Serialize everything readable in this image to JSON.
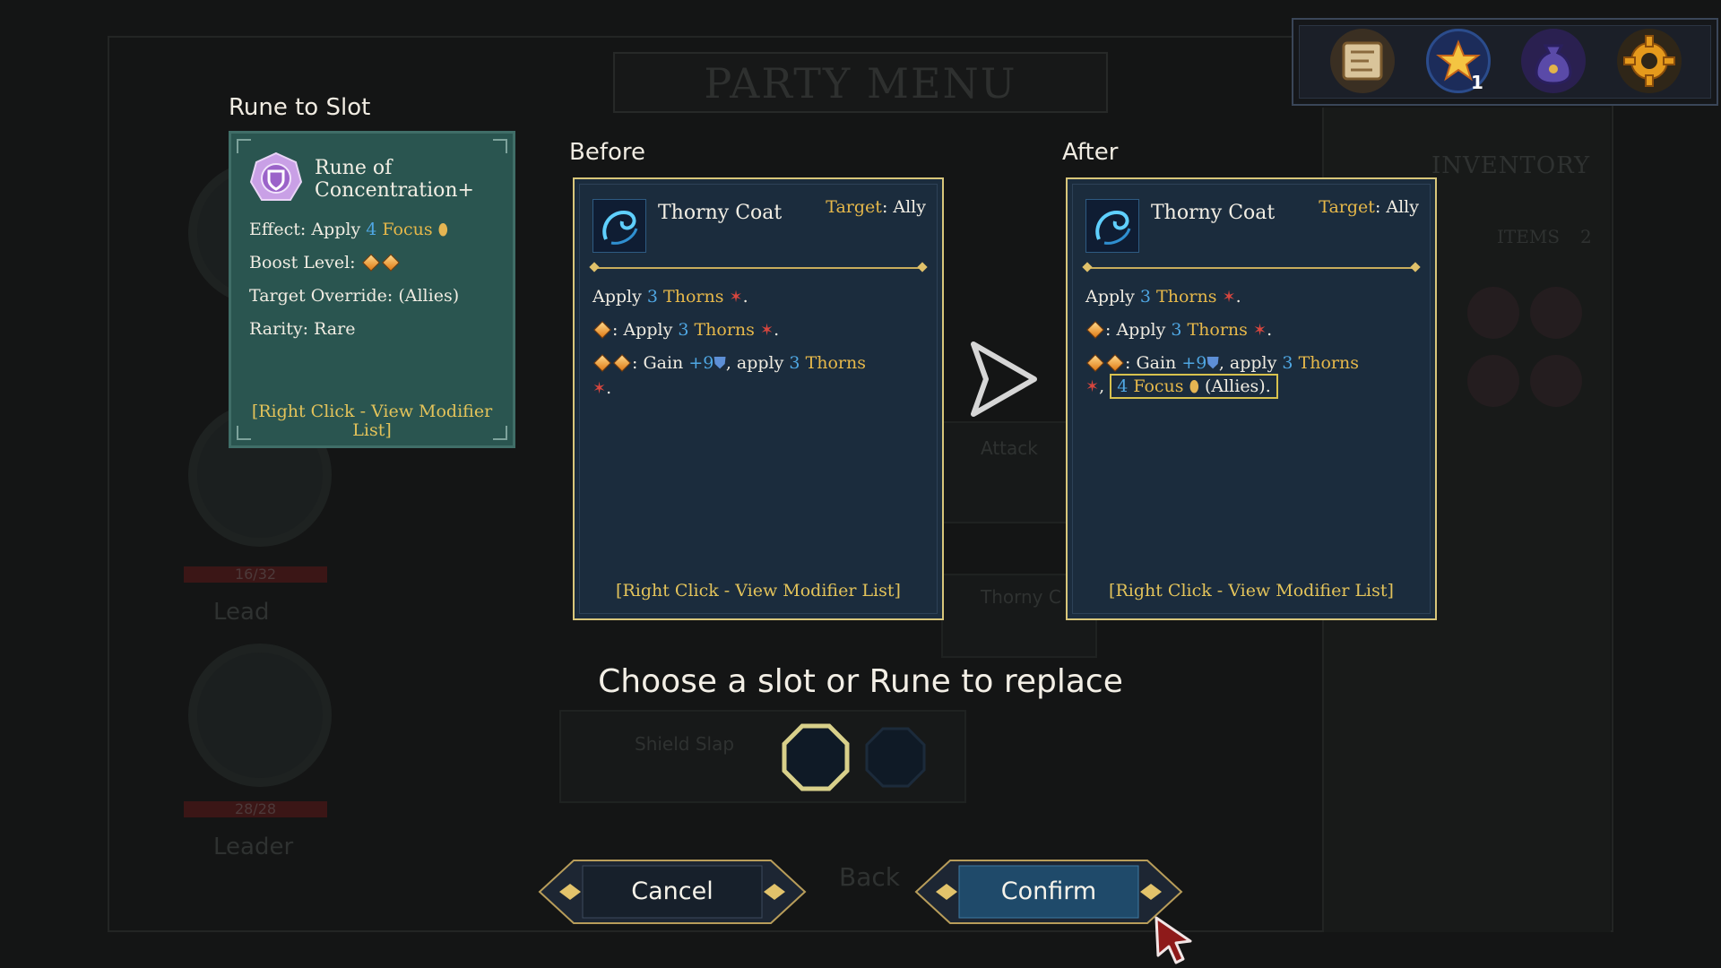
{
  "background": {
    "title": "PARTY MENU",
    "inventory_title": "INVENTORY",
    "inventory_items_label": "ITEMS",
    "inventory_items_count": "2",
    "hp_1": "16/32",
    "hp_2": "28/28",
    "role_1": "Lead",
    "role_2": "Leader",
    "back_label": "Back",
    "skill_attack": "Attack",
    "skill_shield_slap": "Shield Slap",
    "skill_thorny": "Thorny C"
  },
  "toolbar": {
    "items": [
      {
        "name": "map-scroll-icon",
        "glyph": "📜"
      },
      {
        "name": "star-points-icon",
        "glyph": "✦",
        "badge": "1"
      },
      {
        "name": "pouch-icon",
        "glyph": "👝"
      },
      {
        "name": "settings-gear-icon",
        "glyph": "⚙"
      }
    ]
  },
  "rune_to_slot": {
    "heading": "Rune to Slot",
    "name": "Rune of Concentration+",
    "effect_label": "Effect: Apply",
    "effect_amount": "4",
    "effect_status": "Focus",
    "boost_label": "Boost Level:",
    "target_override": "Target Override: (Allies)",
    "rarity": "Rarity: Rare",
    "hint": "[Right Click - View Modifier List]"
  },
  "before": {
    "heading": "Before",
    "name": "Thorny Coat",
    "target_label": "Target",
    "target_value": ": Ally",
    "line1_prefix": "Apply",
    "line1_amount": "3",
    "line1_status": "Thorns",
    "line2_prefix": ": Apply",
    "line2_amount": "3",
    "line2_status": "Thorns",
    "line3_prefix": ": Gain",
    "line3_gain": "+9",
    "line3_mid": ", apply",
    "line3_amount": "3",
    "line3_status": "Thorns",
    "hint": "[Right Click - View Modifier List]"
  },
  "after": {
    "heading": "After",
    "name": "Thorny Coat",
    "target_label": "Target",
    "target_value": ": Ally",
    "line1_prefix": "Apply",
    "line1_amount": "3",
    "line1_status": "Thorns",
    "line2_prefix": ": Apply",
    "line2_amount": "3",
    "line2_status": "Thorns",
    "line3_prefix": ": Gain",
    "line3_gain": "+9",
    "line3_mid": ", apply",
    "line3_amount": "3",
    "line3_status": "Thorns",
    "added_amount": "4",
    "added_status": "Focus",
    "added_suffix": "(Allies).",
    "hint": "[Right Click - View Modifier List]"
  },
  "prompt": "Choose a slot or Rune to replace",
  "buttons": {
    "cancel": "Cancel",
    "confirm": "Confirm"
  },
  "colors": {
    "rune_card_bg": "#2a5550",
    "skill_card_bg": "#1b2c3d",
    "gold_text": "#e6b84a",
    "blue_text": "#4fa7e3",
    "hint_text": "#e3c35a"
  }
}
